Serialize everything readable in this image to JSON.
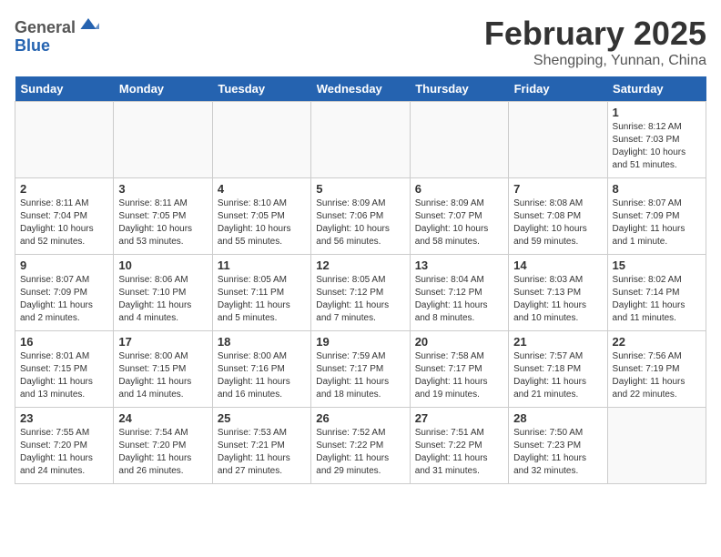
{
  "logo": {
    "general": "General",
    "blue": "Blue"
  },
  "title": "February 2025",
  "location": "Shengping, Yunnan, China",
  "days_of_week": [
    "Sunday",
    "Monday",
    "Tuesday",
    "Wednesday",
    "Thursday",
    "Friday",
    "Saturday"
  ],
  "weeks": [
    [
      {
        "day": "",
        "info": ""
      },
      {
        "day": "",
        "info": ""
      },
      {
        "day": "",
        "info": ""
      },
      {
        "day": "",
        "info": ""
      },
      {
        "day": "",
        "info": ""
      },
      {
        "day": "",
        "info": ""
      },
      {
        "day": "1",
        "info": "Sunrise: 8:12 AM\nSunset: 7:03 PM\nDaylight: 10 hours\nand 51 minutes."
      }
    ],
    [
      {
        "day": "2",
        "info": "Sunrise: 8:11 AM\nSunset: 7:04 PM\nDaylight: 10 hours\nand 52 minutes."
      },
      {
        "day": "3",
        "info": "Sunrise: 8:11 AM\nSunset: 7:05 PM\nDaylight: 10 hours\nand 53 minutes."
      },
      {
        "day": "4",
        "info": "Sunrise: 8:10 AM\nSunset: 7:05 PM\nDaylight: 10 hours\nand 55 minutes."
      },
      {
        "day": "5",
        "info": "Sunrise: 8:09 AM\nSunset: 7:06 PM\nDaylight: 10 hours\nand 56 minutes."
      },
      {
        "day": "6",
        "info": "Sunrise: 8:09 AM\nSunset: 7:07 PM\nDaylight: 10 hours\nand 58 minutes."
      },
      {
        "day": "7",
        "info": "Sunrise: 8:08 AM\nSunset: 7:08 PM\nDaylight: 10 hours\nand 59 minutes."
      },
      {
        "day": "8",
        "info": "Sunrise: 8:07 AM\nSunset: 7:09 PM\nDaylight: 11 hours\nand 1 minute."
      }
    ],
    [
      {
        "day": "9",
        "info": "Sunrise: 8:07 AM\nSunset: 7:09 PM\nDaylight: 11 hours\nand 2 minutes."
      },
      {
        "day": "10",
        "info": "Sunrise: 8:06 AM\nSunset: 7:10 PM\nDaylight: 11 hours\nand 4 minutes."
      },
      {
        "day": "11",
        "info": "Sunrise: 8:05 AM\nSunset: 7:11 PM\nDaylight: 11 hours\nand 5 minutes."
      },
      {
        "day": "12",
        "info": "Sunrise: 8:05 AM\nSunset: 7:12 PM\nDaylight: 11 hours\nand 7 minutes."
      },
      {
        "day": "13",
        "info": "Sunrise: 8:04 AM\nSunset: 7:12 PM\nDaylight: 11 hours\nand 8 minutes."
      },
      {
        "day": "14",
        "info": "Sunrise: 8:03 AM\nSunset: 7:13 PM\nDaylight: 11 hours\nand 10 minutes."
      },
      {
        "day": "15",
        "info": "Sunrise: 8:02 AM\nSunset: 7:14 PM\nDaylight: 11 hours\nand 11 minutes."
      }
    ],
    [
      {
        "day": "16",
        "info": "Sunrise: 8:01 AM\nSunset: 7:15 PM\nDaylight: 11 hours\nand 13 minutes."
      },
      {
        "day": "17",
        "info": "Sunrise: 8:00 AM\nSunset: 7:15 PM\nDaylight: 11 hours\nand 14 minutes."
      },
      {
        "day": "18",
        "info": "Sunrise: 8:00 AM\nSunset: 7:16 PM\nDaylight: 11 hours\nand 16 minutes."
      },
      {
        "day": "19",
        "info": "Sunrise: 7:59 AM\nSunset: 7:17 PM\nDaylight: 11 hours\nand 18 minutes."
      },
      {
        "day": "20",
        "info": "Sunrise: 7:58 AM\nSunset: 7:17 PM\nDaylight: 11 hours\nand 19 minutes."
      },
      {
        "day": "21",
        "info": "Sunrise: 7:57 AM\nSunset: 7:18 PM\nDaylight: 11 hours\nand 21 minutes."
      },
      {
        "day": "22",
        "info": "Sunrise: 7:56 AM\nSunset: 7:19 PM\nDaylight: 11 hours\nand 22 minutes."
      }
    ],
    [
      {
        "day": "23",
        "info": "Sunrise: 7:55 AM\nSunset: 7:20 PM\nDaylight: 11 hours\nand 24 minutes."
      },
      {
        "day": "24",
        "info": "Sunrise: 7:54 AM\nSunset: 7:20 PM\nDaylight: 11 hours\nand 26 minutes."
      },
      {
        "day": "25",
        "info": "Sunrise: 7:53 AM\nSunset: 7:21 PM\nDaylight: 11 hours\nand 27 minutes."
      },
      {
        "day": "26",
        "info": "Sunrise: 7:52 AM\nSunset: 7:22 PM\nDaylight: 11 hours\nand 29 minutes."
      },
      {
        "day": "27",
        "info": "Sunrise: 7:51 AM\nSunset: 7:22 PM\nDaylight: 11 hours\nand 31 minutes."
      },
      {
        "day": "28",
        "info": "Sunrise: 7:50 AM\nSunset: 7:23 PM\nDaylight: 11 hours\nand 32 minutes."
      },
      {
        "day": "",
        "info": ""
      }
    ]
  ]
}
